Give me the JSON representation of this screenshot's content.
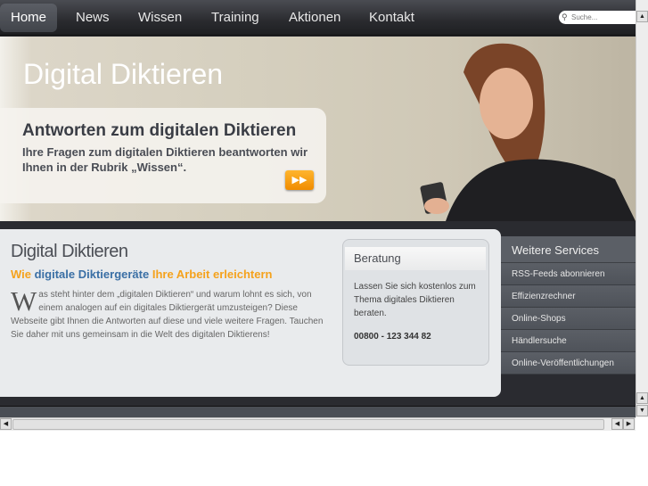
{
  "nav": {
    "items": [
      "Home",
      "News",
      "Wissen",
      "Training",
      "Aktionen",
      "Kontakt"
    ],
    "search_placeholder": "Suche..."
  },
  "banner": {
    "title": "Digital Diktieren",
    "teaser_heading": "Antworten zum digitalen Diktieren",
    "teaser_text": "Ihre Fragen zum digitalen Diktieren beantworten wir Ihnen in der Rubrik „Wissen“.",
    "button_icon": "fast-forward-icon"
  },
  "main": {
    "title": "Digital Diktieren",
    "subtitle_1": "Wie ",
    "subtitle_2": "digitale Diktiergeräte",
    "subtitle_3": " Ihre Arbeit erleichtern",
    "dropcap": "W",
    "body": "as steht hinter dem „digitalen Diktieren“ und warum lohnt es sich, von einem analogen auf ein digitales Diktiergerät umzusteigen? Diese Webseite gibt Ihnen die Antworten auf diese und viele weitere Fragen. Tauchen Sie daher mit uns gemeinsam in die Welt des digitalen Diktierens!"
  },
  "beratung": {
    "title": "Beratung",
    "text": "Lassen Sie sich kostenlos zum Thema digitales Diktieren beraten.",
    "phone": "00800 - 123 344 82"
  },
  "services": {
    "title": "Weitere Services",
    "items": [
      "RSS-Feeds abonnieren",
      "Effizienzrechner",
      "Online-Shops",
      "Händlersuche",
      "Online-Veröffentlichungen"
    ]
  },
  "colors": {
    "accent": "#f5a21c",
    "link": "#3a6fa5"
  }
}
